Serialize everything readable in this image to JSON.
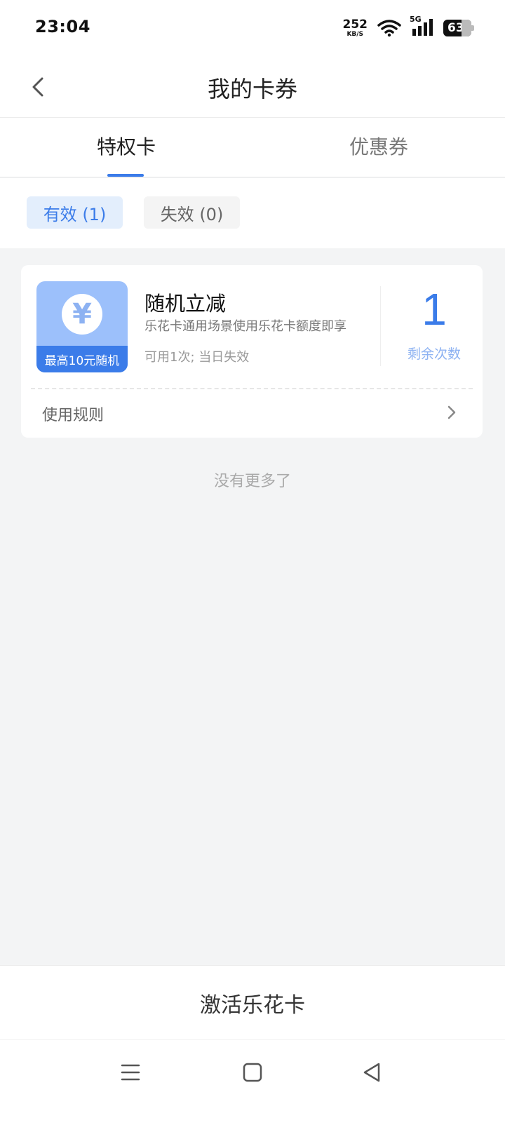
{
  "status_bar": {
    "time": "23:04",
    "net_speed": "252",
    "net_speed_unit": "KB/S",
    "network_type": "5G",
    "battery_level": "63"
  },
  "header": {
    "title": "我的卡券"
  },
  "tabs": [
    {
      "label": "特权卡",
      "active": true
    },
    {
      "label": "优惠券",
      "active": false
    }
  ],
  "filters": [
    {
      "label": "有效 (1)",
      "active": true
    },
    {
      "label": "失效 (0)",
      "active": false
    }
  ],
  "card": {
    "icon": "yuan-coin-icon",
    "thumb_label": "最高10元随机",
    "title": "随机立减",
    "description": "乐花卡通用场景使用乐花卡额度即享",
    "validity": "可用1次; 当日失效",
    "remaining_count": "1",
    "remaining_label": "剩余次数",
    "rules_label": "使用规则"
  },
  "no_more_text": "没有更多了",
  "bottom_button": {
    "label": "激活乐花卡"
  },
  "colors": {
    "accent": "#3b7ce9",
    "accent_light": "#9cc0fb",
    "background": "#f3f4f5"
  }
}
